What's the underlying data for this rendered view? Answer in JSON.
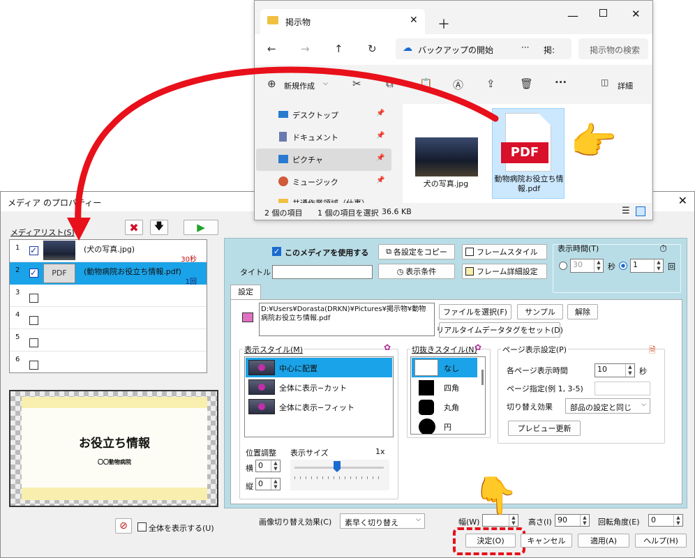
{
  "explorer": {
    "tab_title": "掲示物",
    "address": "バックアップの開始",
    "address_more": "掲:",
    "search_placeholder": "掲示物の検索",
    "new_label": "新規作成",
    "detail_label": "詳細",
    "nav": [
      {
        "label": "デスクトップ"
      },
      {
        "label": "ドキュメント"
      },
      {
        "label": "ピクチャ"
      },
      {
        "label": "ミュージック"
      },
      {
        "label": "共通作業領域（仕事）"
      }
    ],
    "files": [
      {
        "label": "犬の写真.jpg"
      },
      {
        "label": "動物病院お役立ち情報.pdf"
      }
    ],
    "pdf_badge": "PDF",
    "status": {
      "count": "2 個の項目",
      "selected": "1 個の項目を選択",
      "size": "36.6 KB"
    }
  },
  "dialog": {
    "title": "メディア のプロパティー",
    "media_list_label": "メディアリスト(S)",
    "media_items": [
      {
        "num": "1",
        "name": "(犬の写真.jpg)",
        "dur": "30秒"
      },
      {
        "num": "2",
        "name": "(動物病院お役立ち情報.pdf)",
        "dur": "1回",
        "badge": "PDF"
      },
      {
        "num": "3"
      },
      {
        "num": "4"
      },
      {
        "num": "5"
      },
      {
        "num": "6"
      }
    ],
    "preview": {
      "title": "お役立ち情報",
      "sub": "〇〇動物病院"
    },
    "show_all_label": "全体を表示する(U)",
    "use_media": "このメディアを使用する",
    "copy_settings": "各設定をコピー",
    "frame_style": "フレームスタイル",
    "display_cond": "表示条件",
    "frame_detail": "フレーム詳細設定",
    "title_label": "タイトル",
    "display_time": "表示時間(T)",
    "time_sec_val": "30",
    "sec": "秒",
    "time_count_val": "1",
    "times": "回",
    "tab_settings": "設定",
    "file_path": "D:¥Users¥Dorasta(DRKN)¥Pictures¥掲示物¥動物病院お役立ち情報.pdf",
    "select_file": "ファイルを選択(F)",
    "sample": "サンプル",
    "clear": "解除",
    "realtime_tag": "リアルタイムデータタグをセット(D)",
    "disp_style": "表示スタイル(M)",
    "styles": [
      {
        "label": "中心に配置"
      },
      {
        "label": "全体に表示−カット"
      },
      {
        "label": "全体に表示−フィット"
      }
    ],
    "crop_style": "切抜きスタイル(N)",
    "crops": [
      {
        "label": "なし"
      },
      {
        "label": "四角"
      },
      {
        "label": "丸角"
      },
      {
        "label": "円"
      }
    ],
    "page_settings": "ページ表示設定(P)",
    "page_time_label": "各ページ表示時間",
    "page_time_val": "10",
    "page_time_unit": "秒",
    "page_spec_label": "ページ指定(例 1, 3-5)",
    "transition_label": "切り替え効果",
    "transition_val": "部品の設定と同じ",
    "preview_update": "プレビュー更新",
    "position_label": "位置調整",
    "size_label": "表示サイズ",
    "size_val": "1x",
    "horiz": "横",
    "vert": "縦",
    "x_val": "0",
    "y_val": "0",
    "img_transition_label": "画像切り替え効果(C)",
    "img_transition_val": "素早く切り替え",
    "width_label": "幅(W)",
    "height_label": "高さ(I)",
    "height_val": "90",
    "rotate_label": "回転角度(E)",
    "rotate_val": "0",
    "ok": "決定(O)",
    "cancel": "キャンセル",
    "apply": "適用(A)",
    "help": "ヘルプ(H)"
  },
  "colors": {
    "highlight": "#1aa3e8",
    "panel_bg": "#b9dde6",
    "annot_red": "#e8101a"
  }
}
